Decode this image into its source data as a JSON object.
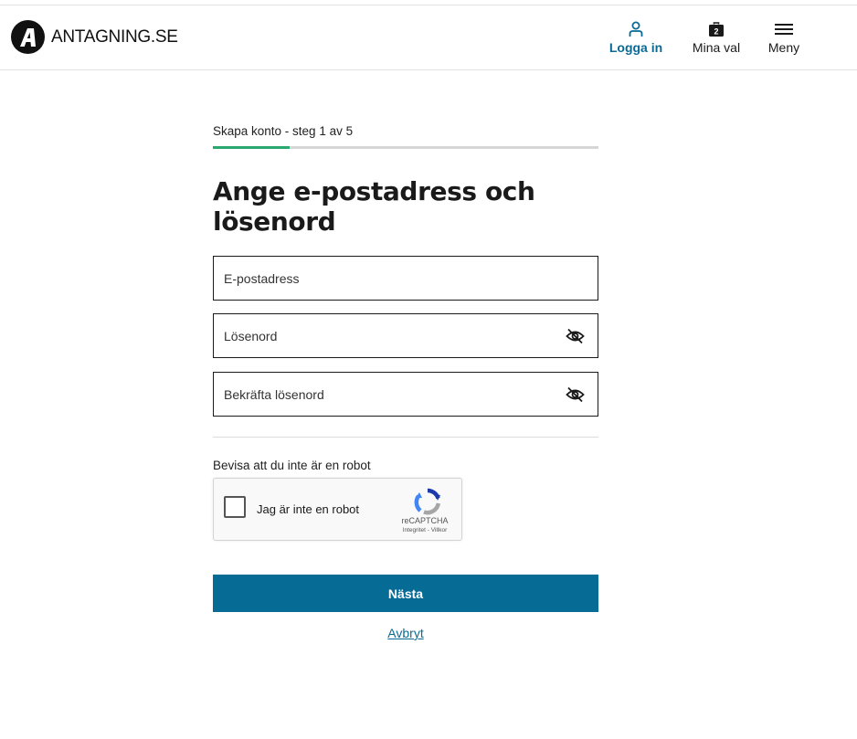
{
  "header": {
    "logo_text": "ANTAGNING.SE",
    "login_label": "Logga in",
    "choices_label": "Mina val",
    "choices_badge": "2",
    "menu_label": "Meny"
  },
  "step": {
    "label": "Skapa konto - steg 1 av 5",
    "current": 1,
    "total": 5
  },
  "form": {
    "title": "Ange e-postadress och lösenord",
    "email_placeholder": "E-postadress",
    "password_placeholder": "Lösenord",
    "confirm_placeholder": "Bekräfta lösenord"
  },
  "captcha": {
    "prompt": "Bevisa att du inte är en robot",
    "checkbox_label": "Jag är inte en robot",
    "brand": "reCAPTCHA",
    "links": "Integritet - Villkor"
  },
  "actions": {
    "next_label": "Nästa",
    "cancel_label": "Avbryt"
  },
  "colors": {
    "accent": "#066c96",
    "progress": "#2aa870"
  }
}
